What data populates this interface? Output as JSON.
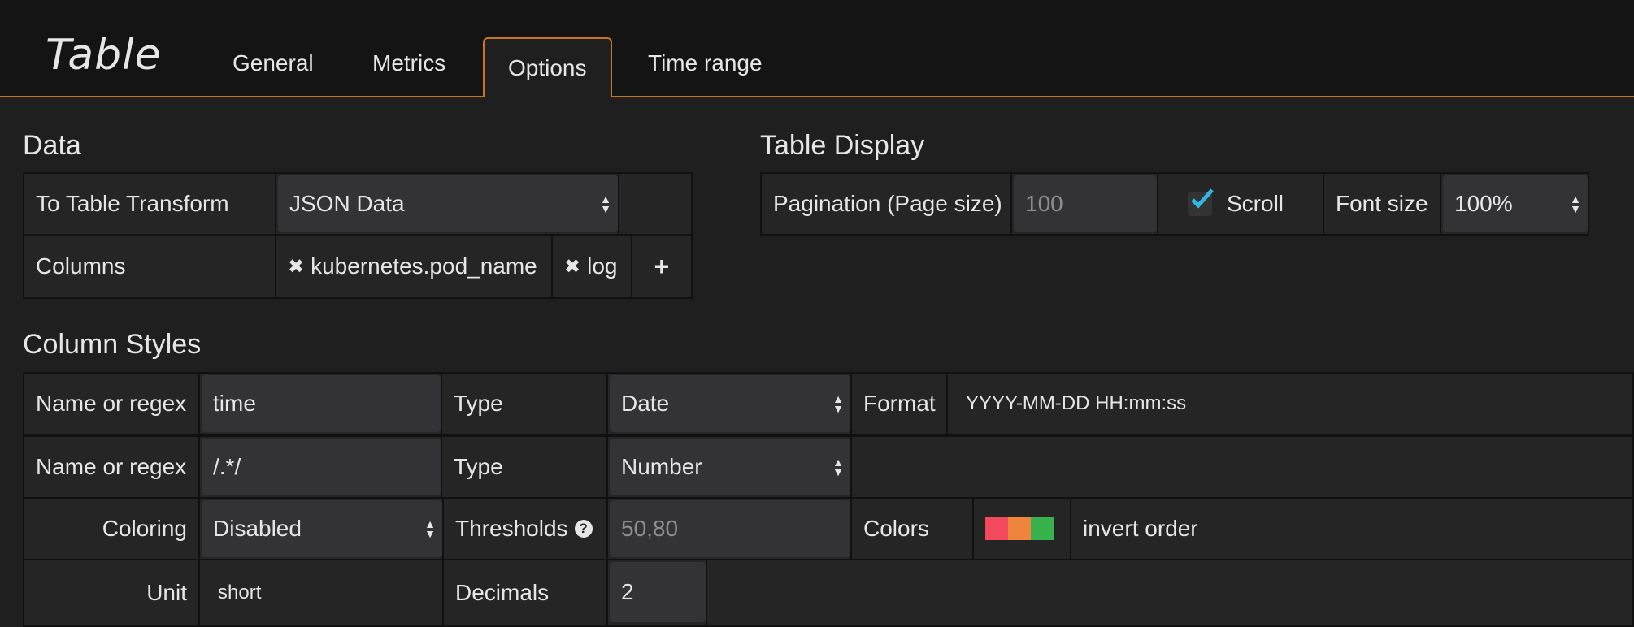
{
  "panel": {
    "title": "Table"
  },
  "tabs": [
    {
      "label": "General"
    },
    {
      "label": "Metrics"
    },
    {
      "label": "Options"
    },
    {
      "label": "Time range"
    }
  ],
  "data_section": {
    "heading": "Data",
    "transform_label": "To Table Transform",
    "transform_value": "JSON Data",
    "columns_label": "Columns",
    "columns": [
      "kubernetes.pod_name",
      "log"
    ],
    "add_symbol": "+"
  },
  "table_display": {
    "heading": "Table Display",
    "pagination_label": "Pagination (Page size)",
    "pagination_placeholder": "100",
    "scroll_label": "Scroll",
    "scroll_checked": true,
    "fontsize_label": "Font size",
    "fontsize_value": "100%"
  },
  "column_styles": {
    "heading": "Column Styles",
    "row1": {
      "name_label": "Name or regex",
      "name_value": "time",
      "type_label": "Type",
      "type_value": "Date",
      "format_label": "Format",
      "format_value": "YYYY-MM-DD HH:mm:ss"
    },
    "row2": {
      "name_label": "Name or regex",
      "name_value": "/.*/",
      "type_label": "Type",
      "type_value": "Number"
    },
    "row3": {
      "coloring_label": "Coloring",
      "coloring_value": "Disabled",
      "thresholds_label": "Thresholds",
      "thresholds_placeholder": "50,80",
      "colors_label": "Colors",
      "colors": [
        "#f2495c",
        "#ef843c",
        "#37b24d"
      ],
      "invert_label": "invert order"
    },
    "row4": {
      "unit_label": "Unit",
      "unit_value": "short",
      "decimals_label": "Decimals",
      "decimals_value": "2"
    }
  }
}
